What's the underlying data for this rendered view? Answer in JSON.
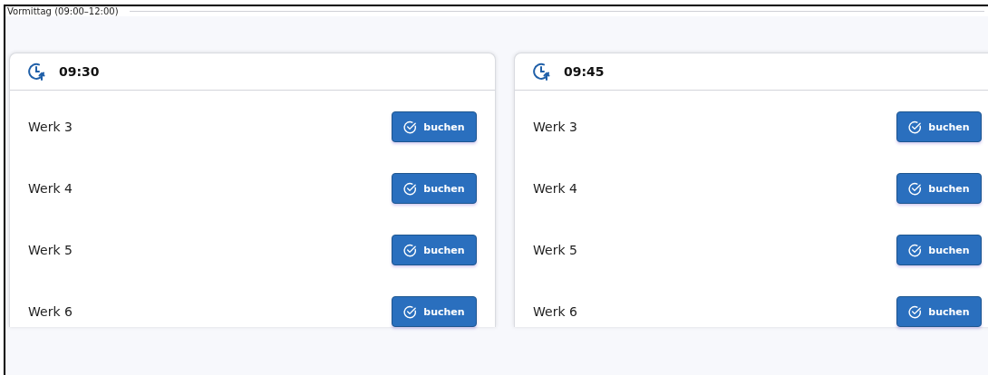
{
  "section": {
    "title": "Vormittag (09:00–12:00)"
  },
  "slots": [
    {
      "time": "09:30",
      "rows": [
        {
          "name": "Werk 3",
          "action": "buchen"
        },
        {
          "name": "Werk 4",
          "action": "buchen"
        },
        {
          "name": "Werk 5",
          "action": "buchen"
        },
        {
          "name": "Werk 6",
          "action": "buchen"
        }
      ]
    },
    {
      "time": "09:45",
      "rows": [
        {
          "name": "Werk 3",
          "action": "buchen"
        },
        {
          "name": "Werk 4",
          "action": "buchen"
        },
        {
          "name": "Werk 5",
          "action": "buchen"
        },
        {
          "name": "Werk 6",
          "action": "buchen"
        }
      ]
    }
  ]
}
